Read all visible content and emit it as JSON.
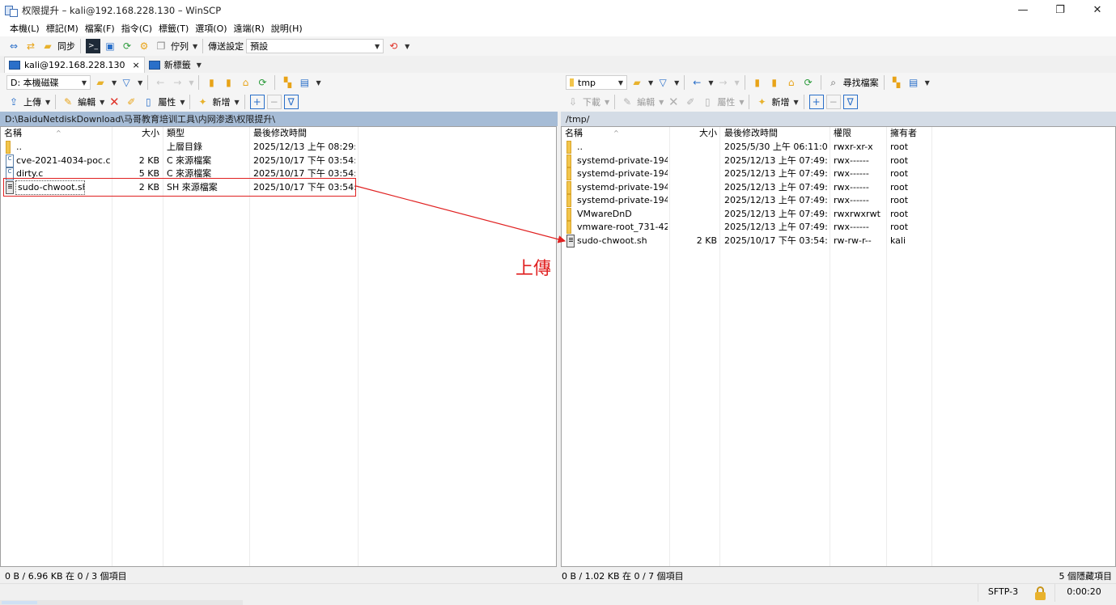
{
  "window": {
    "title": "权限提升 – kali@192.168.228.130 – WinSCP",
    "controls": [
      "—",
      "❐",
      "✕"
    ]
  },
  "menu": [
    "本機(L)",
    "標記(M)",
    "檔案(F)",
    "指令(C)",
    "標籤(T)",
    "選項(O)",
    "遠端(R)",
    "說明(H)"
  ],
  "toolbar": {
    "sync_label": "同步",
    "queue_label": "佇列",
    "transfer_settings_label": "傳送設定",
    "transfer_preset": "預設"
  },
  "tabs": {
    "session": "kali@192.168.228.130",
    "close": "×",
    "new_tab": "新標籤"
  },
  "left": {
    "drive": "D: 本機磁碟",
    "actions": {
      "upload": "上傳",
      "edit": "編輯",
      "properties": "屬性",
      "new": "新增"
    },
    "path": "D:\\BaiduNetdiskDownload\\马哥教育培训工具\\内网渗透\\权限提升\\",
    "columns": {
      "name": "名稱",
      "size": "大小",
      "type": "類型",
      "modified": "最後修改時間"
    },
    "files": [
      {
        "name": "..",
        "size": "",
        "type": "上層目錄",
        "modified": "2025/12/13 上午 08:29:...",
        "icon": "up"
      },
      {
        "name": "cve-2021-4034-poc.c",
        "size": "2 KB",
        "type": "C 來源檔案",
        "modified": "2025/10/17 下午 03:54:...",
        "icon": "c"
      },
      {
        "name": "dirty.c",
        "size": "5 KB",
        "type": "C 來源檔案",
        "modified": "2025/10/17 下午 03:54:...",
        "icon": "c"
      },
      {
        "name": "sudo-chwoot.sh",
        "size": "2 KB",
        "type": "SH 來源檔案",
        "modified": "2025/10/17 下午 03:54:...",
        "icon": "sh"
      }
    ],
    "status": "0 B / 6.96 KB 在 0 / 3 個項目"
  },
  "right": {
    "folder": "tmp",
    "actions": {
      "find": "尋找檔案",
      "download": "下載",
      "edit": "編輯",
      "properties": "屬性",
      "new": "新增"
    },
    "path": "/tmp/",
    "columns": {
      "name": "名稱",
      "size": "大小",
      "modified": "最後修改時間",
      "rights": "權限",
      "owner": "擁有者"
    },
    "files": [
      {
        "name": "..",
        "size": "",
        "modified": "2025/5/30 上午 06:11:00",
        "rights": "rwxr-xr-x",
        "owner": "root",
        "icon": "up"
      },
      {
        "name": "systemd-private-194...",
        "size": "",
        "modified": "2025/12/13 上午 07:49:...",
        "rights": "rwx------",
        "owner": "root",
        "icon": "folder"
      },
      {
        "name": "systemd-private-194...",
        "size": "",
        "modified": "2025/12/13 上午 07:49:...",
        "rights": "rwx------",
        "owner": "root",
        "icon": "folder"
      },
      {
        "name": "systemd-private-194...",
        "size": "",
        "modified": "2025/12/13 上午 07:49:...",
        "rights": "rwx------",
        "owner": "root",
        "icon": "folder"
      },
      {
        "name": "systemd-private-194...",
        "size": "",
        "modified": "2025/12/13 上午 07:49:...",
        "rights": "rwx------",
        "owner": "root",
        "icon": "folder"
      },
      {
        "name": "VMwareDnD",
        "size": "",
        "modified": "2025/12/13 上午 07:49:...",
        "rights": "rwxrwxrwt",
        "owner": "root",
        "icon": "folder"
      },
      {
        "name": "vmware-root_731-42...",
        "size": "",
        "modified": "2025/12/13 上午 07:49:...",
        "rights": "rwx------",
        "owner": "root",
        "icon": "folder"
      },
      {
        "name": "sudo-chwoot.sh",
        "size": "2 KB",
        "modified": "2025/10/17 下午 03:54:...",
        "rights": "rw-rw-r--",
        "owner": "kali",
        "icon": "sh"
      }
    ],
    "status": "0 B / 1.02 KB 在 0 / 7 個項目",
    "hidden": "5 個隱藏項目"
  },
  "bottom": {
    "protocol": "SFTP-3",
    "elapsed": "0:00:20"
  },
  "annotation": {
    "text": "上傳",
    "color": "#e02020"
  }
}
